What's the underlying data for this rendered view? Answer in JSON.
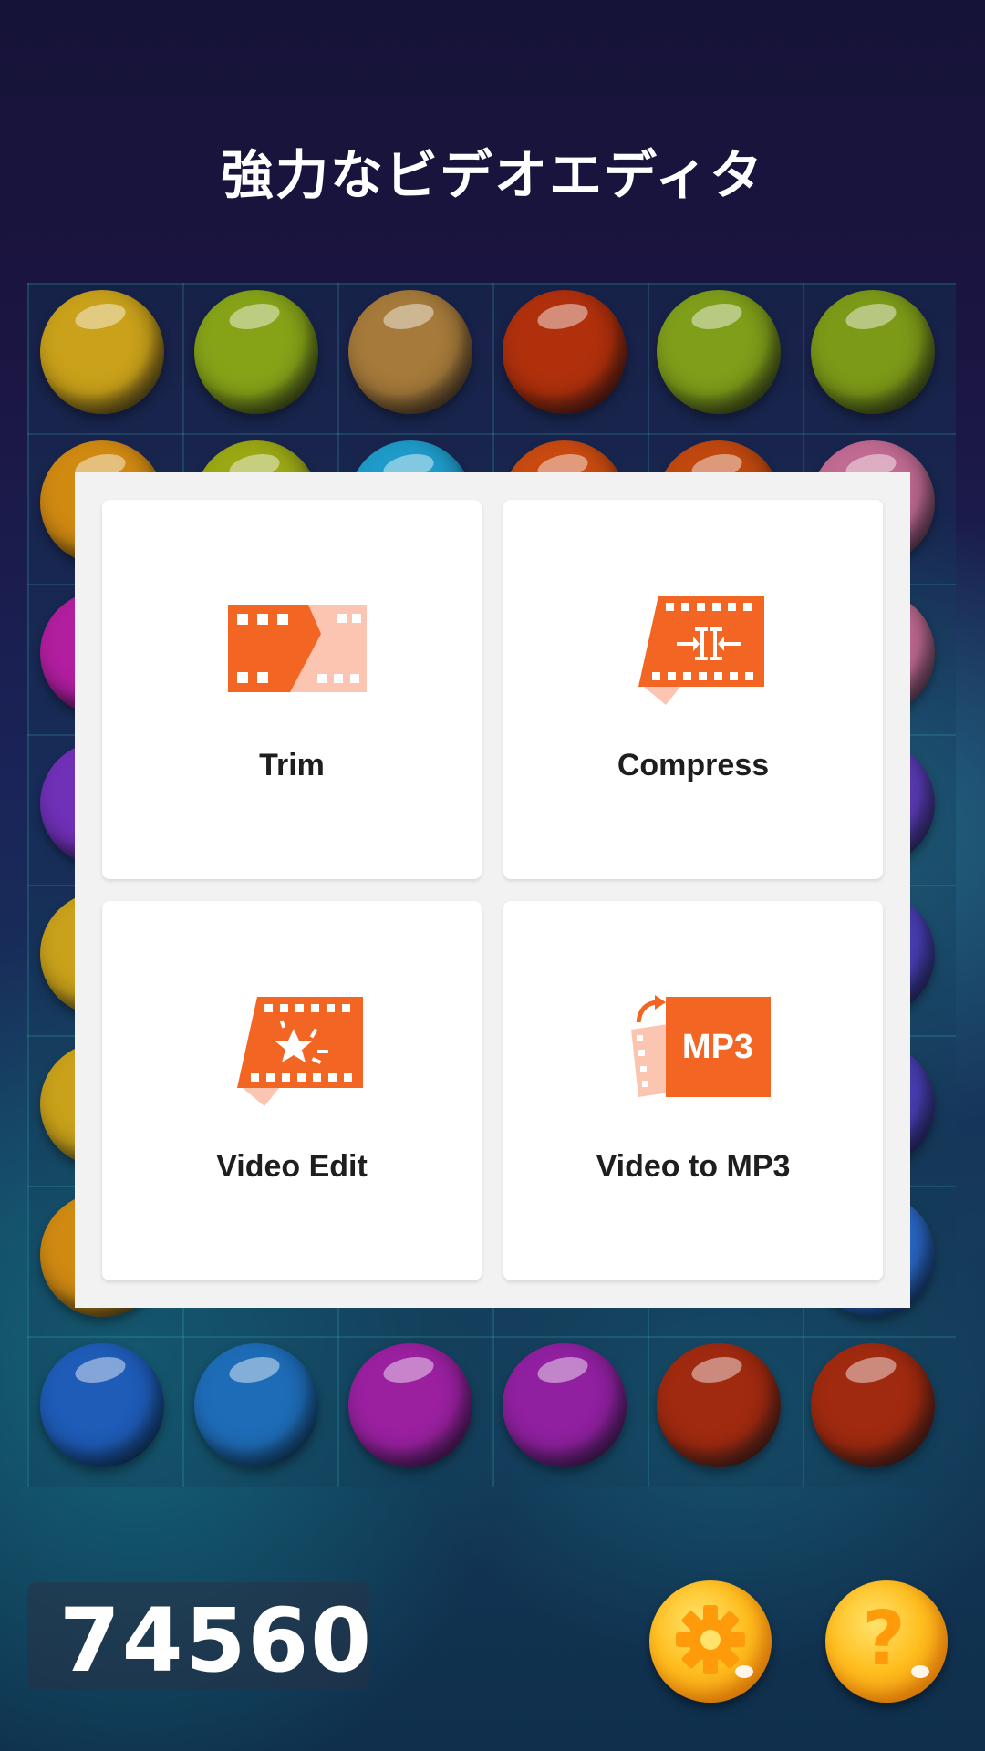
{
  "header": {
    "title": "強力なビデオエディタ"
  },
  "board": {
    "rows": [
      [
        "#c9a11a",
        "#86a318",
        "#a57a3a",
        "#b0300c",
        "#7f9e1a",
        "#7c9a18"
      ],
      [
        "#d08a12",
        "#9aa814",
        "#1e9bc9",
        "#c84a10",
        "#c0480f",
        "#c06b92"
      ],
      [
        "#b21ea0",
        "",
        "",
        "",
        "",
        "#c06b92"
      ],
      [
        "#7030b8",
        "",
        "",
        "",
        "",
        "#5a3cb8"
      ],
      [
        "#c9a11a",
        "",
        "",
        "",
        "",
        "#4a40b8"
      ],
      [
        "#c9a11a",
        "",
        "",
        "",
        "",
        "#4a40b8"
      ],
      [
        "#d08a12",
        "",
        "",
        "",
        "",
        "#2a68c8"
      ],
      [
        "#1e5cb8",
        "#1e6cb8",
        "#9a20a0",
        "#9020a0",
        "#a02a10",
        "#a02a10"
      ]
    ]
  },
  "menu": {
    "items": [
      {
        "label": "Trim",
        "icon": "trim-film-icon"
      },
      {
        "label": "Compress",
        "icon": "compress-film-icon"
      },
      {
        "label": "Video Edit",
        "icon": "video-edit-star-icon"
      },
      {
        "label": "Video to MP3",
        "icon": "mp3-convert-icon",
        "badge": "MP3"
      }
    ],
    "accent": "#f26522"
  },
  "footer": {
    "score": "74560",
    "settings_icon": "gear-icon",
    "help_icon": "question-icon"
  }
}
